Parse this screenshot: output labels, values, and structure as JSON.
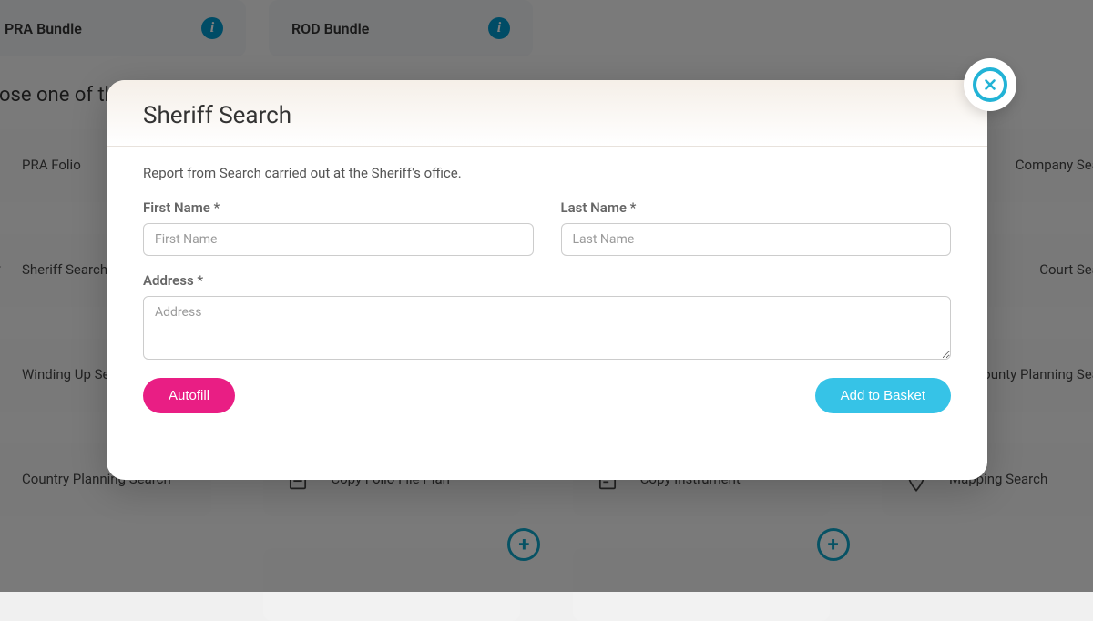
{
  "bundles": [
    {
      "label": "PRA Bundle"
    },
    {
      "label": "ROD Bundle"
    }
  ],
  "section_heading": "Choose one of the following",
  "services": {
    "row1": [
      {
        "label": "PRA Folio"
      },
      {
        "label": ""
      },
      {
        "label": ""
      },
      {
        "label": "Company Search"
      }
    ],
    "row2": [
      {
        "label": "Sheriff Search"
      },
      {
        "label": ""
      },
      {
        "label": ""
      },
      {
        "label": "Court Search"
      }
    ],
    "row3": [
      {
        "label": "Winding Up Search"
      },
      {
        "label": ""
      },
      {
        "label": ""
      },
      {
        "label": "City & County Planning Search"
      }
    ],
    "row4": [
      {
        "label": "Country Planning Search"
      },
      {
        "label": "Copy Folio File Plan"
      },
      {
        "label": "Copy Instrument"
      },
      {
        "label": "Mapping Search"
      }
    ]
  },
  "modal": {
    "title": "Sheriff Search",
    "description": "Report from Search carried out at the Sheriff's office.",
    "first_name_label": "First Name *",
    "first_name_placeholder": "First Name",
    "last_name_label": "Last Name *",
    "last_name_placeholder": "Last Name",
    "address_label": "Address *",
    "address_placeholder": "Address",
    "autofill_label": "Autofill",
    "add_to_basket_label": "Add to Basket"
  }
}
